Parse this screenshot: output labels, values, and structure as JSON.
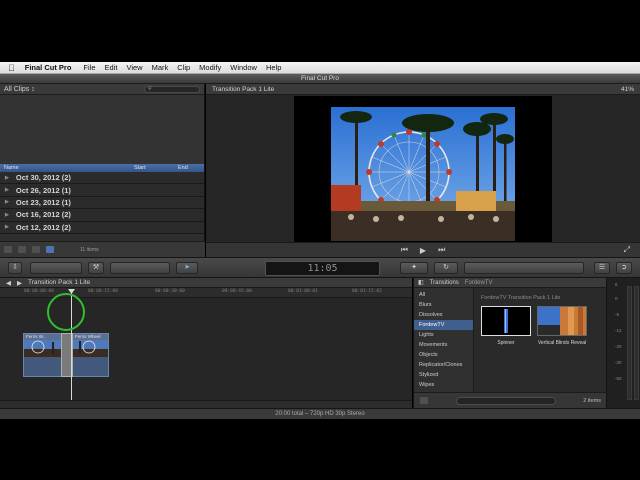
{
  "menubar": {
    "app_name": "Final Cut Pro",
    "items": [
      "File",
      "Edit",
      "View",
      "Mark",
      "Clip",
      "Modify",
      "Window",
      "Help"
    ]
  },
  "window": {
    "title": "Final Cut Pro"
  },
  "browser": {
    "filter": "All Clips ↕",
    "columns": {
      "name": "Name",
      "start": "Start",
      "end": "End"
    },
    "rows": [
      {
        "label": "Oct 30, 2012  (2)"
      },
      {
        "label": "Oct 26, 2012  (1)"
      },
      {
        "label": "Oct 23, 2012  (1)"
      },
      {
        "label": "Oct 16, 2012  (2)"
      },
      {
        "label": "Oct 12, 2012  (2)"
      }
    ],
    "item_count": "11 items"
  },
  "viewer": {
    "title": "Transition Pack 1 Lite",
    "zoom": "41%"
  },
  "toolbar": {
    "timecode": "11:05"
  },
  "timeline": {
    "project_title": "Transition Pack 1 Lite",
    "ticks": [
      "00:00:00:00",
      "00:00:15:00",
      "00:00:30:00",
      "00:00:45:00",
      "00:01:00:01",
      "00:01:15:02"
    ],
    "clip1_title": "Ferris W...",
    "clip2_title": "Ferris Wheel"
  },
  "transitions": {
    "title": "Transitions",
    "breadcrumb": "FordewTV",
    "categories": [
      {
        "label": "All",
        "selected": false
      },
      {
        "label": "Blurs",
        "selected": false
      },
      {
        "label": "Dissolves",
        "selected": false
      },
      {
        "label": "FordewTV",
        "selected": true
      },
      {
        "label": "Lights",
        "selected": false
      },
      {
        "label": "Movements",
        "selected": false
      },
      {
        "label": "Objects",
        "selected": false
      },
      {
        "label": "Replicator/Clones",
        "selected": false
      },
      {
        "label": "Stylized",
        "selected": false
      },
      {
        "label": "Wipes",
        "selected": false
      }
    ],
    "group_title": "FordewTV Transition Pack 1 Lite",
    "tiles": [
      {
        "label": "Spinner"
      },
      {
        "label": "Vertical Blinds Reveal"
      }
    ],
    "item_count": "2 items"
  },
  "meter": {
    "labels": [
      "6",
      "0",
      "-6",
      "-12",
      "-20",
      "-30",
      "-50"
    ]
  },
  "status": {
    "text": "20:00 total – 720p HD 30p Stereo"
  },
  "colors": {
    "selection_blue": "#3f5f8f",
    "clip_blue": "#42597c",
    "cursor_ring": "#2ec12e"
  }
}
